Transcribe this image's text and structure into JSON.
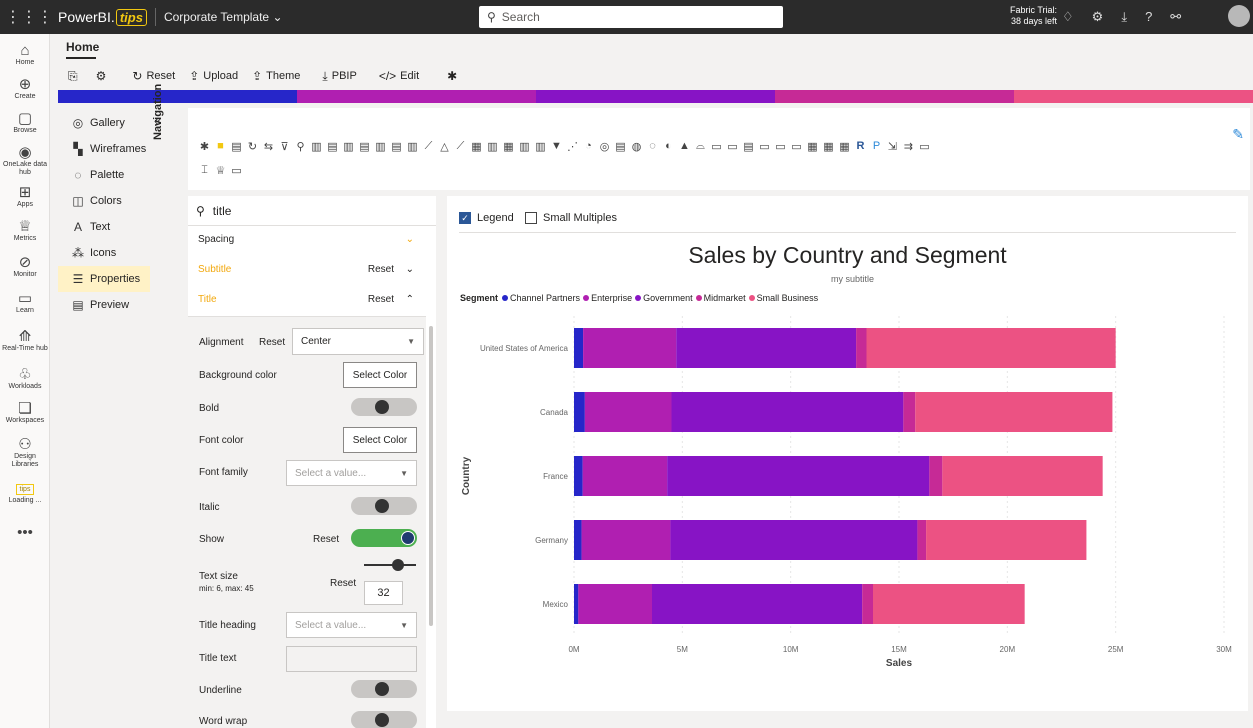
{
  "topbar": {
    "brand": "PowerBI.",
    "brand_tips": "tips",
    "workspace": "Corporate Template",
    "search_placeholder": "Search",
    "trial_line1": "Fabric Trial:",
    "trial_line2": "38 days left"
  },
  "rail": {
    "items": [
      {
        "label": "Home",
        "icon": "home-icon",
        "glyph": "⌂"
      },
      {
        "label": "Create",
        "icon": "plus-icon",
        "glyph": "⊕"
      },
      {
        "label": "Browse",
        "icon": "folder-icon",
        "glyph": "▢"
      },
      {
        "label": "OneLake data hub",
        "icon": "onelake-icon",
        "glyph": "◉"
      },
      {
        "label": "Apps",
        "icon": "apps-icon",
        "glyph": "⊞"
      },
      {
        "label": "Metrics",
        "icon": "trophy-icon",
        "glyph": "♕"
      },
      {
        "label": "Monitor",
        "icon": "monitor-icon",
        "glyph": "⊘"
      },
      {
        "label": "Learn",
        "icon": "book-icon",
        "glyph": "▭"
      },
      {
        "label": "Real-Time hub",
        "icon": "realtime-icon",
        "glyph": "⟰"
      },
      {
        "label": "Workloads",
        "icon": "workloads-icon",
        "glyph": "♧"
      },
      {
        "label": "Workspaces",
        "icon": "workspaces-icon",
        "glyph": "❏"
      },
      {
        "label": "Design Libraries",
        "icon": "design-libraries-icon",
        "glyph": "⚇"
      },
      {
        "label": "Loading ...",
        "icon": "tips-icon",
        "glyph": "tips"
      },
      {
        "label": "",
        "icon": "more-icon",
        "glyph": "•••"
      }
    ]
  },
  "home_tab": "Home",
  "ribbon": {
    "reset": "Reset",
    "upload": "Upload",
    "theme": "Theme",
    "pbip": "PBIP",
    "edit": "Edit"
  },
  "colorbar": [
    "#2626c9",
    "#b01fb1",
    "#8714c5",
    "#c62a96",
    "#ec5283"
  ],
  "nav": {
    "vertical_label": "Navigation",
    "items": [
      {
        "label": "Gallery",
        "icon": "gallery-icon",
        "glyph": "◎"
      },
      {
        "label": "Wireframes",
        "icon": "wireframes-icon",
        "glyph": "▚"
      },
      {
        "label": "Palette",
        "icon": "palette-icon",
        "glyph": "◌"
      },
      {
        "label": "Colors",
        "icon": "bucket-icon",
        "glyph": "◫"
      },
      {
        "label": "Text",
        "icon": "text-icon",
        "glyph": "A"
      },
      {
        "label": "Icons",
        "icon": "icons-icon",
        "glyph": "⁂"
      },
      {
        "label": "Properties",
        "icon": "properties-icon",
        "glyph": "☰"
      },
      {
        "label": "Preview",
        "icon": "preview-icon",
        "glyph": "▤"
      }
    ]
  },
  "props": {
    "search_value": "title",
    "spacing": "Spacing",
    "subtitle": "Subtitle",
    "title": "Title",
    "reset": "Reset",
    "alignment": "Alignment",
    "alignment_value": "Center",
    "background_color": "Background color",
    "select_color": "Select Color",
    "bold": "Bold",
    "font_color": "Font color",
    "font_family": "Font family",
    "select_value": "Select a value...",
    "italic": "Italic",
    "show": "Show",
    "text_size": "Text size",
    "text_size_range": "min: 6, max: 45",
    "text_size_value": "32",
    "title_heading": "Title heading",
    "title_text": "Title text",
    "underline": "Underline",
    "word_wrap": "Word wrap"
  },
  "canvas": {
    "legend_toggle": "Legend",
    "small_multiples": "Small Multiples"
  },
  "chart_data": {
    "type": "bar",
    "orientation": "horizontal",
    "stacked": true,
    "title": "Sales by Country and Segment",
    "subtitle": "my subtitle",
    "legend_title": "Segment",
    "xlabel": "Sales",
    "ylabel": "Country",
    "xlim": [
      0,
      30000000
    ],
    "x_ticks": [
      "0M",
      "5M",
      "10M",
      "15M",
      "20M",
      "25M",
      "30M"
    ],
    "categories": [
      "United States of America",
      "Canada",
      "France",
      "Germany",
      "Mexico"
    ],
    "series": [
      {
        "name": "Channel Partners",
        "color": "#2626c9",
        "values": [
          420000,
          500000,
          400000,
          350000,
          200000
        ]
      },
      {
        "name": "Enterprise",
        "color": "#b01fb1",
        "values": [
          4300000,
          4000000,
          3900000,
          4100000,
          3400000
        ]
      },
      {
        "name": "Government",
        "color": "#8714c5",
        "values": [
          8300000,
          10700000,
          12100000,
          11400000,
          9700000
        ]
      },
      {
        "name": "Midmarket",
        "color": "#c62a96",
        "values": [
          480000,
          550000,
          600000,
          400000,
          500000
        ]
      },
      {
        "name": "Small Business",
        "color": "#ec5283",
        "values": [
          11500000,
          9100000,
          7400000,
          7400000,
          7000000
        ]
      }
    ]
  }
}
